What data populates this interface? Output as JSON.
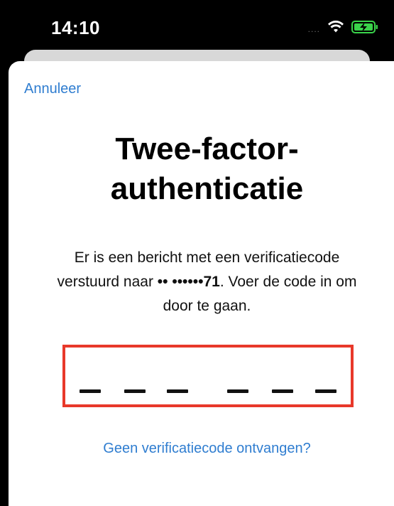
{
  "status_bar": {
    "time": "14:10",
    "signal": "....",
    "wifi_icon": "wifi-icon",
    "battery_icon": "battery-charging-icon",
    "battery_color": "#3ad34a"
  },
  "header": {
    "cancel_label": "Annuleer"
  },
  "main": {
    "title": "Twee-factor-\nauthenticatie",
    "message_part1": "Er is een bericht met een verificatiecode verstuurd naar ",
    "masked_number": "•• ••••••71",
    "message_part2": ". Voer de code in om door te gaan.",
    "code_slots": [
      "",
      "",
      "",
      "",
      "",
      ""
    ],
    "highlight_color": "#e8382a",
    "resend_label": "Geen verificatiecode ontvangen?"
  },
  "accent_color": "#2f7dd0"
}
